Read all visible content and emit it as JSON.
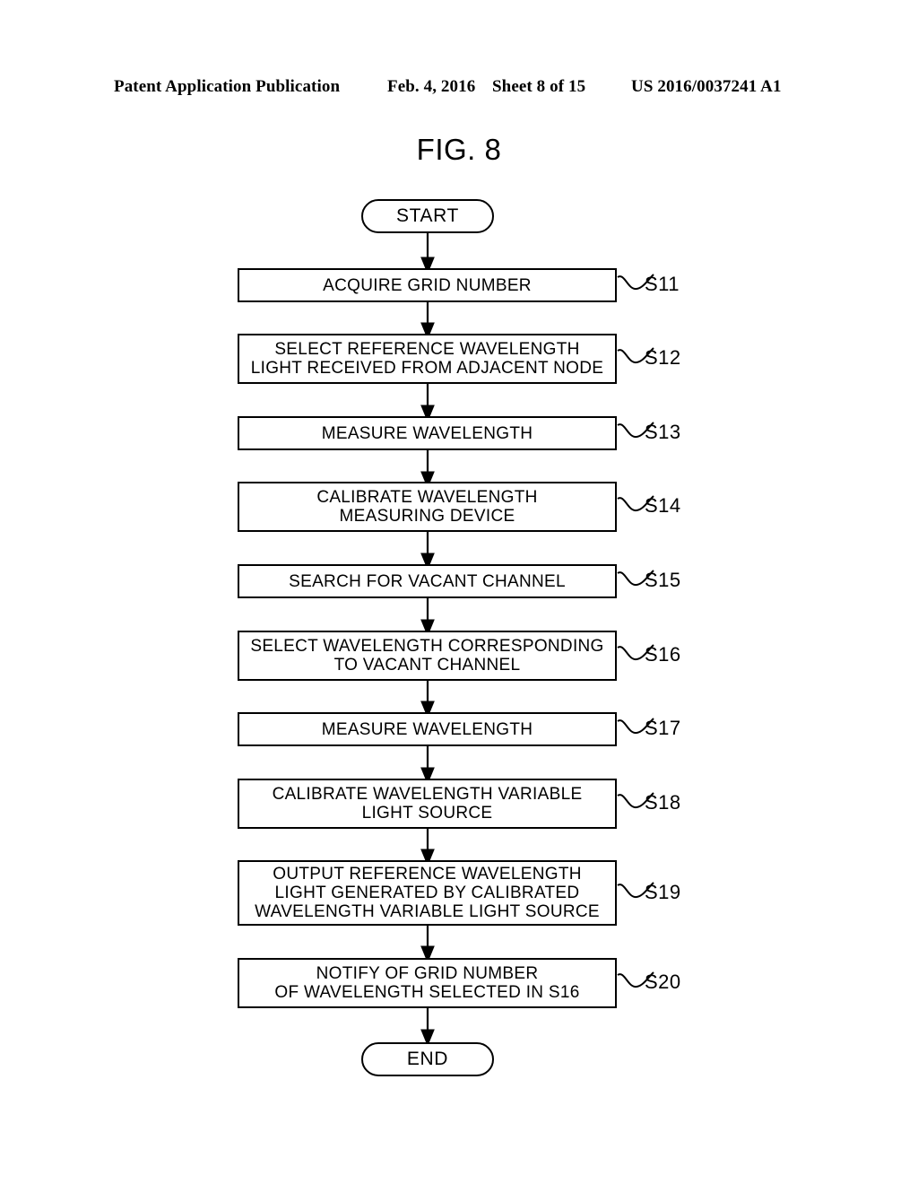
{
  "header": {
    "publication": "Patent Application Publication",
    "date": "Feb. 4, 2016",
    "sheet": "Sheet 8 of 15",
    "patent_number": "US 2016/0037241 A1"
  },
  "figure": {
    "title": "FIG. 8"
  },
  "flowchart": {
    "start_label": "START",
    "end_label": "END",
    "steps": [
      {
        "id": "S11",
        "text": "ACQUIRE GRID NUMBER",
        "lines": 1
      },
      {
        "id": "S12",
        "text": "SELECT REFERENCE WAVELENGTH\nLIGHT RECEIVED FROM ADJACENT NODE",
        "lines": 2
      },
      {
        "id": "S13",
        "text": "MEASURE WAVELENGTH",
        "lines": 1
      },
      {
        "id": "S14",
        "text": "CALIBRATE WAVELENGTH\nMEASURING DEVICE",
        "lines": 2
      },
      {
        "id": "S15",
        "text": "SEARCH FOR VACANT CHANNEL",
        "lines": 1
      },
      {
        "id": "S16",
        "text": "SELECT WAVELENGTH CORRESPONDING\nTO VACANT CHANNEL",
        "lines": 2
      },
      {
        "id": "S17",
        "text": "MEASURE WAVELENGTH",
        "lines": 1
      },
      {
        "id": "S18",
        "text": "CALIBRATE WAVELENGTH VARIABLE\nLIGHT SOURCE",
        "lines": 2
      },
      {
        "id": "S19",
        "text": "OUTPUT REFERENCE WAVELENGTH\nLIGHT GENERATED BY CALIBRATED\nWAVELENGTH VARIABLE LIGHT SOURCE",
        "lines": 3
      },
      {
        "id": "S20",
        "text": "NOTIFY OF GRID NUMBER\nOF WAVELENGTH SELECTED IN S16",
        "lines": 2
      }
    ]
  },
  "colors": {
    "ink": "#000000",
    "paper": "#ffffff"
  }
}
